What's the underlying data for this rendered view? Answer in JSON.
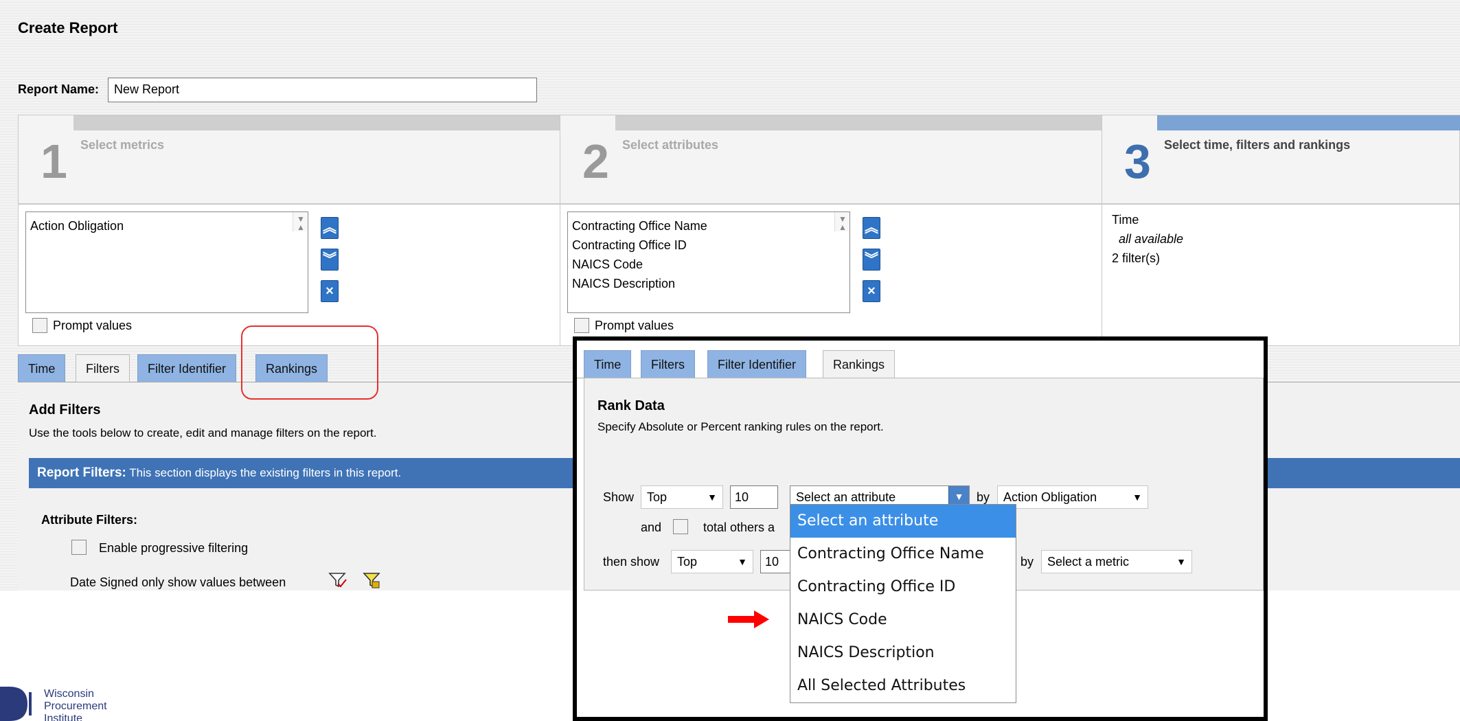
{
  "page": {
    "title": "Create Report",
    "report_name_label": "Report Name:",
    "report_name_value": "New Report"
  },
  "steps": [
    {
      "number": "1",
      "label": "Select metrics"
    },
    {
      "number": "2",
      "label": "Select attributes"
    },
    {
      "number": "3",
      "label": "Select time, filters and rankings"
    }
  ],
  "metrics": {
    "items": [
      "Action Obligation"
    ],
    "prompt_label": "Prompt values"
  },
  "attributes": {
    "items": [
      "Contracting Office Name",
      "Contracting Office ID",
      "NAICS Code",
      "NAICS Description"
    ],
    "prompt_label": "Prompt values"
  },
  "time_summary": {
    "label": "Time",
    "value": "all available",
    "filters": "2 filter(s)"
  },
  "tabs": [
    "Time",
    "Filters",
    "Filter Identifier",
    "Rankings"
  ],
  "filters_section": {
    "title": "Add Filters",
    "description": "Use the tools below to create, edit and manage filters on the report.",
    "bar_title": "Report Filters:",
    "bar_text": "This section displays the existing filters in this report.",
    "attribute_filters_label": "Attribute Filters:",
    "progressive_label": "Enable progressive filtering",
    "date_signed_text": "Date Signed only show values between"
  },
  "rankings": {
    "title": "Rank Data",
    "description": "Specify Absolute or Percent ranking rules on the report.",
    "show_label": "Show",
    "show_type": "Top",
    "show_count": "10",
    "attribute_select": "Select an attribute",
    "by_label": "by",
    "metric_select": "Action Obligation",
    "and_label": "and",
    "total_others_label": "total others a",
    "then_show_label": "then show",
    "then_type": "Top",
    "then_count": "10",
    "then_metric": "Select a metric"
  },
  "dropdown_options": [
    "Select an attribute",
    "Contracting Office Name",
    "Contracting Office ID",
    "NAICS Code",
    "NAICS Description",
    "All Selected Attributes"
  ],
  "logo": {
    "line1": "Wisconsin",
    "line2": "Procurement",
    "line3": "Institute"
  },
  "colors": {
    "accent_blue": "#3f73b6",
    "tab_blue": "#8fb4e3",
    "highlight_blue": "#3c8fe6",
    "annotation_red": "#e53030"
  }
}
